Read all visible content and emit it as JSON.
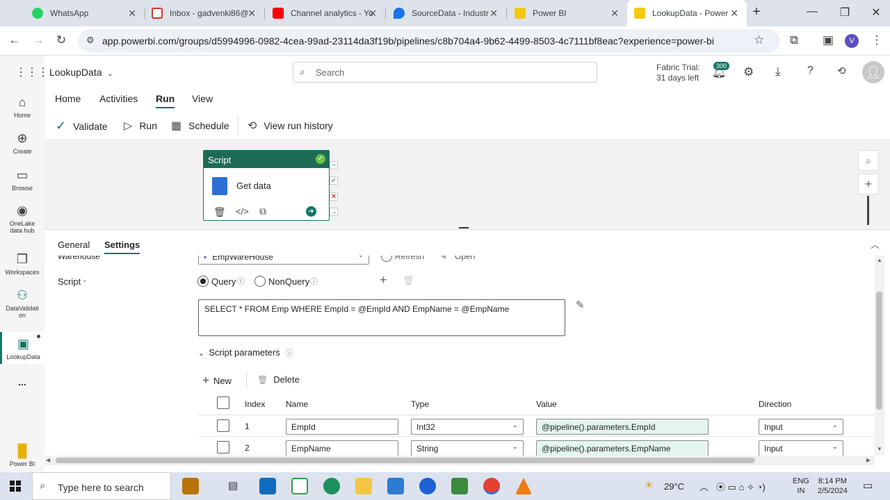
{
  "browser": {
    "tabs": [
      {
        "title": "WhatsApp",
        "color": "#25d366"
      },
      {
        "title": "Inbox - gadvenki86@",
        "color": "#d93025"
      },
      {
        "title": "Channel analytics - Yo",
        "color": "#ff0000"
      },
      {
        "title": "SourceData - Industr",
        "color": "#1a73e8"
      },
      {
        "title": "Power BI",
        "color": "#f2c811"
      },
      {
        "title": "LookupData - Power",
        "color": "#f2c811"
      }
    ],
    "url": "app.powerbi.com/groups/d5994996-0982-4cea-99ad-23114da3f19b/pipelines/c8b704a4-9b62-4499-8503-4c7111bf8eac?experience=power-bi",
    "profile_initial": "V"
  },
  "header": {
    "workspace_name": "LookupData",
    "search_placeholder": "Search",
    "trial_line1": "Fabric Trial:",
    "trial_line2": "31 days left",
    "notification_count": "300"
  },
  "rail": {
    "items": [
      {
        "label": "Home",
        "icon": "home-icon"
      },
      {
        "label": "Create",
        "icon": "plus-circle-icon"
      },
      {
        "label": "Browse",
        "icon": "folder-icon"
      },
      {
        "label": "OneLake data hub",
        "icon": "onelake-icon"
      },
      {
        "label": "Workspaces",
        "icon": "workspaces-icon"
      },
      {
        "label": "DataValidati on",
        "icon": "people-icon"
      },
      {
        "label": "LookupData",
        "icon": "pipeline-icon"
      },
      {
        "label": "Power BI",
        "icon": "powerbi-icon"
      }
    ],
    "more": "..."
  },
  "ribbon": {
    "tabs": [
      "Home",
      "Activities",
      "Run",
      "View"
    ],
    "active_tab": "Run",
    "buttons": {
      "validate": "Validate",
      "run": "Run",
      "schedule": "Schedule",
      "view_history": "View run history"
    }
  },
  "canvas": {
    "node_type": "Script",
    "node_name": "Get data"
  },
  "panel": {
    "tabs": [
      "General",
      "Settings"
    ],
    "active_tab": "Settings",
    "warehouse_label": "Warehouse",
    "warehouse_value": "EmpWareHouse",
    "refresh_label": "Refresh",
    "open_label": "Open",
    "script_label": "Script",
    "required_mark": "*",
    "query_option": "Query",
    "nonquery_option": "NonQuery",
    "selected_option": "Query",
    "script_text": "SELECT * FROM Emp WHERE EmpId = @EmpId AND EmpName = @EmpName",
    "script_params_label": "Script parameters",
    "new_label": "New",
    "delete_label": "Delete",
    "columns": [
      "Index",
      "Name",
      "Type",
      "Value",
      "Direction"
    ],
    "rows": [
      {
        "index": "1",
        "name": "EmpId",
        "type": "Int32",
        "value": "@pipeline().parameters.EmpId",
        "direction": "Input"
      },
      {
        "index": "2",
        "name": "EmpName",
        "type": "String",
        "value": "@pipeline().parameters.EmpName",
        "direction": "Input"
      }
    ]
  },
  "taskbar": {
    "search_placeholder": "Type here to search",
    "weather": "29°C",
    "lang_line1": "ENG",
    "lang_line2": "IN",
    "time": "8:14 PM",
    "date": "2/5/2024"
  }
}
